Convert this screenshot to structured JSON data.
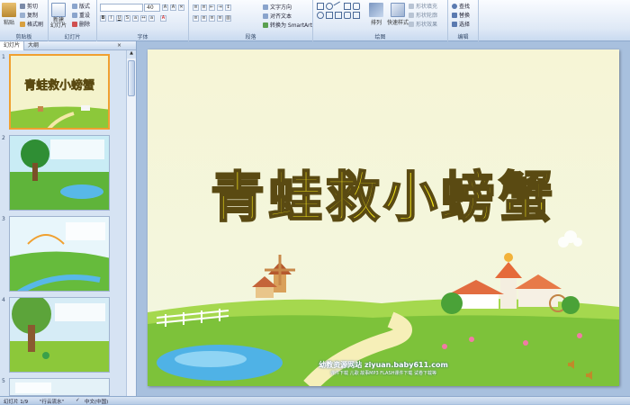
{
  "ribbon": {
    "clipboard": {
      "paste": "粘贴",
      "cut": "剪切",
      "copy": "复制",
      "format_painter": "格式刷",
      "label": "剪贴板"
    },
    "slides": {
      "new_slide": "新建\n幻灯片",
      "layout": "版式",
      "reset": "重设",
      "delete": "删除",
      "label": "幻灯片"
    },
    "font": {
      "font_name": "",
      "font_size": "40",
      "label": "字体"
    },
    "paragraph": {
      "text_direction": "文字方向",
      "align_text": "对齐文本",
      "smartart": "转换为 SmartArt",
      "label": "段落"
    },
    "drawing": {
      "arrange": "排列",
      "quick_styles": "快速样式",
      "shape_fill": "形状填充",
      "shape_outline": "形状轮廓",
      "shape_effects": "形状效果",
      "label": "绘图"
    },
    "editing": {
      "find": "查找",
      "replace": "替换",
      "select": "选择",
      "label": "编辑"
    }
  },
  "panel": {
    "tabs": [
      "幻灯片",
      "大纲"
    ],
    "thumbnails": [
      {
        "number": "1",
        "title": "青蛙救小螃蟹"
      },
      {
        "number": "2"
      },
      {
        "number": "3"
      },
      {
        "number": "4"
      },
      {
        "number": "5"
      }
    ]
  },
  "slide": {
    "title": "青蛙救小螃蟹",
    "site": "幼教资源网站  ziyuan.baby611.com",
    "sub": "课件下载  儿歌  故事MP3  FLASH课件下载  试卷下载等"
  },
  "status": {
    "slide_info": "幻灯片 1/9",
    "theme": "\"行云流水\"",
    "language": "中文(中国)"
  },
  "colors": {
    "title_fill": "#f7e81a",
    "selected_border": "#f0a030",
    "ribbon": "#dfe9f6"
  }
}
